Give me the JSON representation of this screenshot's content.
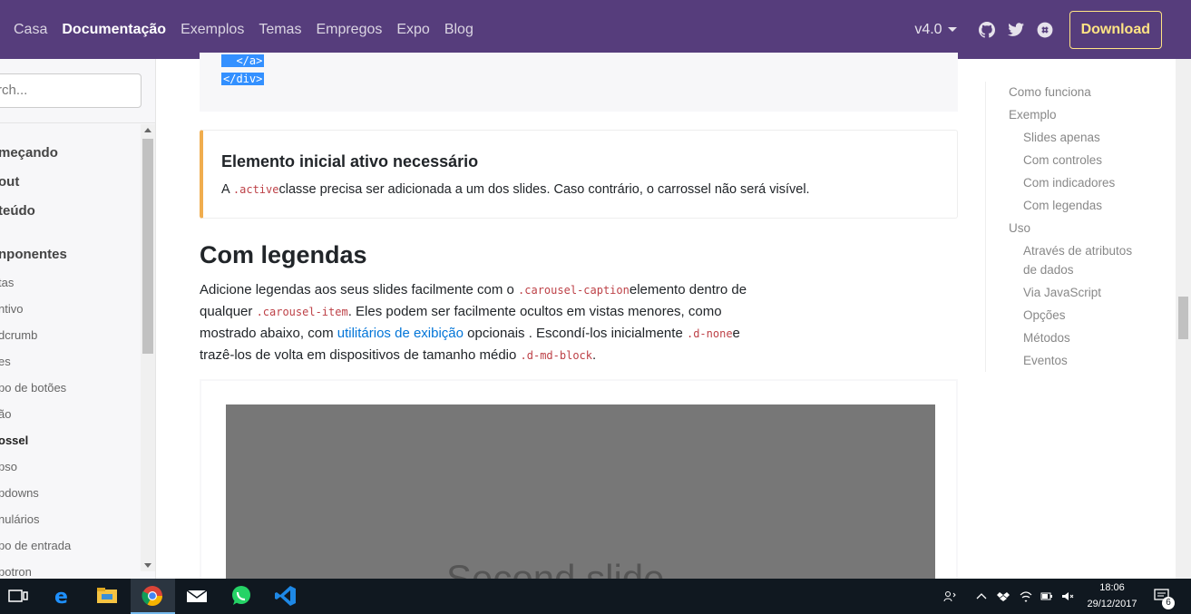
{
  "navbar": {
    "links": [
      "Casa",
      "Documentação",
      "Exemplos",
      "Temas",
      "Empregos",
      "Expo",
      "Blog"
    ],
    "active_index": 1,
    "version": "v4.0",
    "download_label": "Download",
    "icons": [
      "github-icon",
      "twitter-icon",
      "slack-icon"
    ],
    "background": "#563d7c",
    "download_color": "#ffe484"
  },
  "sidebar": {
    "search_placeholder": "rch...",
    "sections": [
      "meçando",
      "out",
      "teúdo",
      "nponentes"
    ],
    "components": [
      "tas",
      "ntivo",
      "dcrumb",
      "es",
      "po de botões",
      "ão",
      "ossel",
      "pso",
      "pdowns",
      "nulários",
      "po de entrada",
      "potron"
    ],
    "current_component": "ossel"
  },
  "code": {
    "line1": "  </a>",
    "line2": "</div>"
  },
  "callout": {
    "title": "Elemento inicial ativo necessário",
    "text_prefix": "A ",
    "code": ".active",
    "text_suffix": "classe precisa ser adicionada a um dos slides. Caso contrário, o carrossel não será visível.",
    "border_color": "#f0ad4e"
  },
  "section": {
    "title": "Com legendas",
    "p1_a": "Adicione legendas aos seus slides facilmente com o ",
    "p1_code": ".carousel-caption",
    "p1_b": "elemento dentro de",
    "p2_a": "qualquer ",
    "p2_code": ".carousel-item",
    "p2_b": ". Eles podem ser facilmente ocultos em vistas menores, como",
    "p3_a": "mostrado abaixo, com ",
    "p3_link": "utilitários de exibição",
    "p3_b": " opcionais . Escondí-los inicialmente ",
    "p3_code": ".d-none",
    "p3_c": "e",
    "p4_a": "trazê-los de volta em dispositivos de tamanho médio ",
    "p4_code": ".d-md-block",
    "p4_b": "."
  },
  "example": {
    "slide_text": "Second slide",
    "prev": "‹",
    "next": "›"
  },
  "toc": {
    "items": [
      {
        "label": "Como funciona",
        "level": 1
      },
      {
        "label": "Exemplo",
        "level": 1
      },
      {
        "label": "Slides apenas",
        "level": 2
      },
      {
        "label": "Com controles",
        "level": 2
      },
      {
        "label": "Com indicadores",
        "level": 2
      },
      {
        "label": "Com legendas",
        "level": 2
      },
      {
        "label": "Uso",
        "level": 1
      },
      {
        "label": "Através de atributos",
        "level": 2
      },
      {
        "label": "de dados",
        "level": 2
      },
      {
        "label": "Via JavaScript",
        "level": 2
      },
      {
        "label": "Opções",
        "level": 2
      },
      {
        "label": "Métodos",
        "level": 2
      },
      {
        "label": "Eventos",
        "level": 2
      }
    ]
  },
  "taskbar": {
    "apps": [
      "task-view-icon",
      "edge-icon",
      "file-explorer-icon",
      "chrome-icon",
      "mail-icon",
      "whatsapp-icon",
      "vscode-icon"
    ],
    "time": "18:06",
    "date": "29/12/2017",
    "notification_count": "6"
  }
}
